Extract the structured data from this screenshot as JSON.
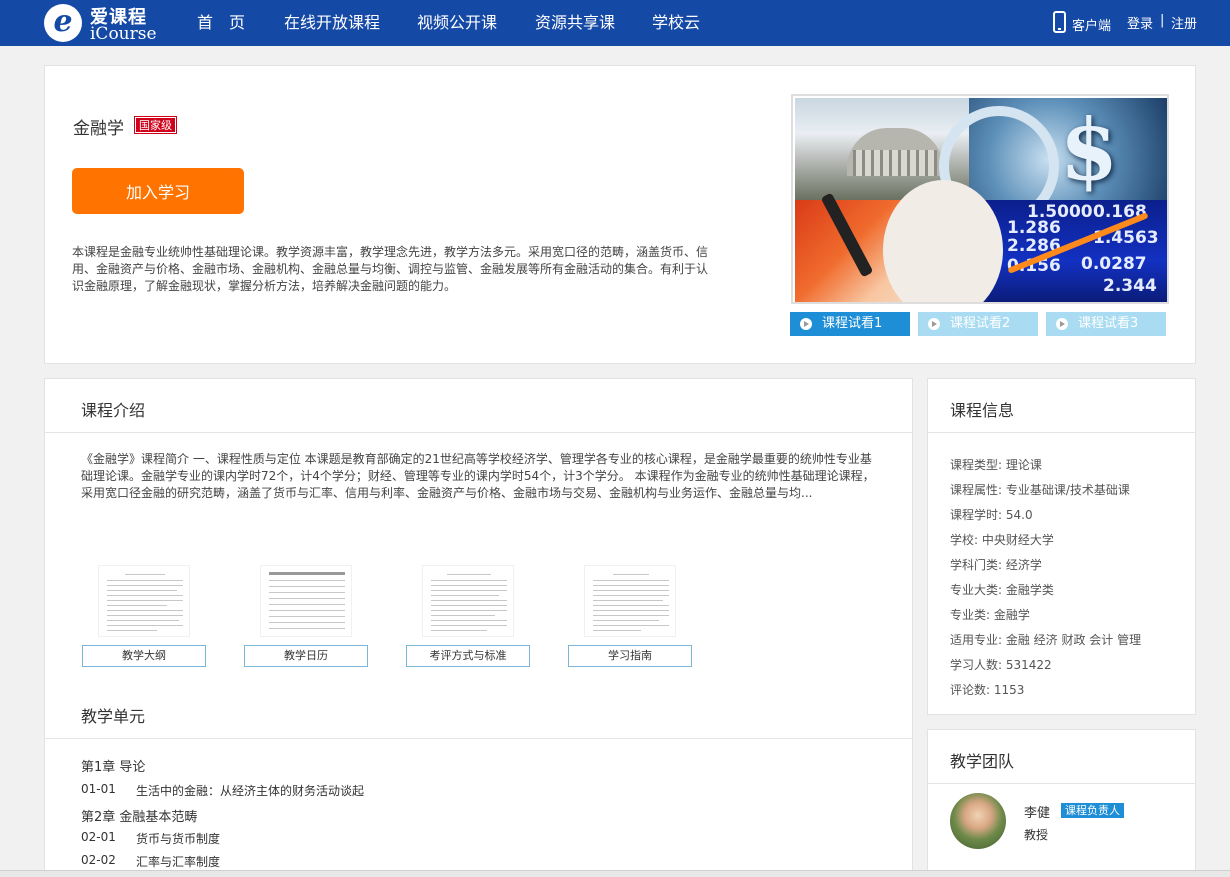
{
  "nav": {
    "logo_cn": "爱课程",
    "logo_en": "iCourse",
    "items": [
      "首　页",
      "在线开放课程",
      "视频公开课",
      "资源共享课",
      "学校云"
    ],
    "client_label": "客户端",
    "login": "登录",
    "sep": "|",
    "register": "注册"
  },
  "course": {
    "title": "金融学",
    "level_badge": "国家级",
    "join_button": "加入学习",
    "description": "本课程是金融专业统帅性基础理论课。教学资源丰富，教学理念先进，教学方法多元。采用宽口径的范畴，涵盖货币、信用、金融资产与价格、金融市场、金融机构、金融总量与均衡、调控与监管、金融发展等所有金融活动的集合。有利于认识金融原理，了解金融现状，掌握分析方法，培养解决金融问题的能力。",
    "board_numbers": [
      "1.5000",
      "0.168",
      "1.286",
      "1.4563",
      "2.286",
      "0.156",
      "0.0287",
      "2.344"
    ],
    "trials": [
      "课程试看1",
      "课程试看2",
      "课程试看3"
    ]
  },
  "intro": {
    "heading": "课程介绍",
    "text": "《金融学》课程简介 一、课程性质与定位 本课题是教育部确定的21世纪高等学校经济学、管理学各专业的核心课程，是金融学最重要的统帅性专业基础理论课。金融学专业的课内学时72个，计4个学分；财经、管理等专业的课内学时54个，计3个学分。 本课程作为金融专业的统帅性基础理论课程，采用宽口径金融的研究范畴，涵盖了货币与汇率、信用与利率、金融资产与价格、金融市场与交易、金融机构与业务运作、金融总量与均...",
    "documents": [
      "教学大纲",
      "教学日历",
      "考评方式与标准",
      "学习指南"
    ],
    "units_heading": "教学单元",
    "chapter1": "第1章 导论",
    "lesson_01_01": {
      "num": "01-01",
      "title": "生活中的金融：从经济主体的财务活动谈起"
    },
    "chapter2": "第2章 金融基本范畴",
    "lesson_02_01": {
      "num": "02-01",
      "title": "货币与货币制度"
    },
    "lesson_02_02": {
      "num": "02-02",
      "title": "汇率与汇率制度"
    }
  },
  "info": {
    "heading": "课程信息",
    "rows": [
      "课程类型: 理论课",
      "课程属性: 专业基础课/技术基础课",
      "课程学时: 54.0",
      "学校: 中央财经大学",
      "学科门类: 经济学",
      "专业大类: 金融学类",
      "专业类: 金融学",
      "适用专业: 金融 经济 财政 会计 管理",
      "学习人数: 531422",
      "评论数: 1153"
    ]
  },
  "team": {
    "heading": "教学团队",
    "name": "李健",
    "role": "课程负责人",
    "title": "教授"
  },
  "colors": {
    "nav_bg": "#1549a6",
    "join_button": "#ff7300",
    "level_badge": "#d0021b",
    "trial_active": "#1e8fd6",
    "trial_inactive": "#a9dcf2",
    "role_badge": "#1e8fd6"
  }
}
